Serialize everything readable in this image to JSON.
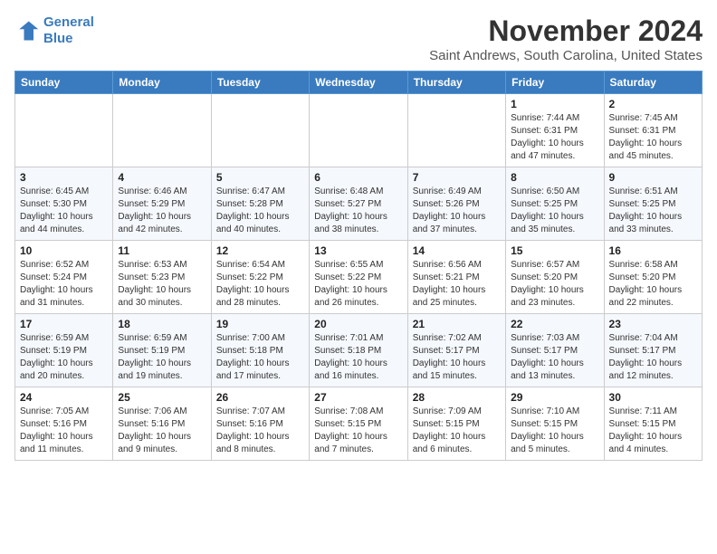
{
  "header": {
    "logo_line1": "General",
    "logo_line2": "Blue",
    "month_title": "November 2024",
    "location": "Saint Andrews, South Carolina, United States"
  },
  "weekdays": [
    "Sunday",
    "Monday",
    "Tuesday",
    "Wednesday",
    "Thursday",
    "Friday",
    "Saturday"
  ],
  "weeks": [
    [
      {
        "day": "",
        "info": ""
      },
      {
        "day": "",
        "info": ""
      },
      {
        "day": "",
        "info": ""
      },
      {
        "day": "",
        "info": ""
      },
      {
        "day": "",
        "info": ""
      },
      {
        "day": "1",
        "info": "Sunrise: 7:44 AM\nSunset: 6:31 PM\nDaylight: 10 hours\nand 47 minutes."
      },
      {
        "day": "2",
        "info": "Sunrise: 7:45 AM\nSunset: 6:31 PM\nDaylight: 10 hours\nand 45 minutes."
      }
    ],
    [
      {
        "day": "3",
        "info": "Sunrise: 6:45 AM\nSunset: 5:30 PM\nDaylight: 10 hours\nand 44 minutes."
      },
      {
        "day": "4",
        "info": "Sunrise: 6:46 AM\nSunset: 5:29 PM\nDaylight: 10 hours\nand 42 minutes."
      },
      {
        "day": "5",
        "info": "Sunrise: 6:47 AM\nSunset: 5:28 PM\nDaylight: 10 hours\nand 40 minutes."
      },
      {
        "day": "6",
        "info": "Sunrise: 6:48 AM\nSunset: 5:27 PM\nDaylight: 10 hours\nand 38 minutes."
      },
      {
        "day": "7",
        "info": "Sunrise: 6:49 AM\nSunset: 5:26 PM\nDaylight: 10 hours\nand 37 minutes."
      },
      {
        "day": "8",
        "info": "Sunrise: 6:50 AM\nSunset: 5:25 PM\nDaylight: 10 hours\nand 35 minutes."
      },
      {
        "day": "9",
        "info": "Sunrise: 6:51 AM\nSunset: 5:25 PM\nDaylight: 10 hours\nand 33 minutes."
      }
    ],
    [
      {
        "day": "10",
        "info": "Sunrise: 6:52 AM\nSunset: 5:24 PM\nDaylight: 10 hours\nand 31 minutes."
      },
      {
        "day": "11",
        "info": "Sunrise: 6:53 AM\nSunset: 5:23 PM\nDaylight: 10 hours\nand 30 minutes."
      },
      {
        "day": "12",
        "info": "Sunrise: 6:54 AM\nSunset: 5:22 PM\nDaylight: 10 hours\nand 28 minutes."
      },
      {
        "day": "13",
        "info": "Sunrise: 6:55 AM\nSunset: 5:22 PM\nDaylight: 10 hours\nand 26 minutes."
      },
      {
        "day": "14",
        "info": "Sunrise: 6:56 AM\nSunset: 5:21 PM\nDaylight: 10 hours\nand 25 minutes."
      },
      {
        "day": "15",
        "info": "Sunrise: 6:57 AM\nSunset: 5:20 PM\nDaylight: 10 hours\nand 23 minutes."
      },
      {
        "day": "16",
        "info": "Sunrise: 6:58 AM\nSunset: 5:20 PM\nDaylight: 10 hours\nand 22 minutes."
      }
    ],
    [
      {
        "day": "17",
        "info": "Sunrise: 6:59 AM\nSunset: 5:19 PM\nDaylight: 10 hours\nand 20 minutes."
      },
      {
        "day": "18",
        "info": "Sunrise: 6:59 AM\nSunset: 5:19 PM\nDaylight: 10 hours\nand 19 minutes."
      },
      {
        "day": "19",
        "info": "Sunrise: 7:00 AM\nSunset: 5:18 PM\nDaylight: 10 hours\nand 17 minutes."
      },
      {
        "day": "20",
        "info": "Sunrise: 7:01 AM\nSunset: 5:18 PM\nDaylight: 10 hours\nand 16 minutes."
      },
      {
        "day": "21",
        "info": "Sunrise: 7:02 AM\nSunset: 5:17 PM\nDaylight: 10 hours\nand 15 minutes."
      },
      {
        "day": "22",
        "info": "Sunrise: 7:03 AM\nSunset: 5:17 PM\nDaylight: 10 hours\nand 13 minutes."
      },
      {
        "day": "23",
        "info": "Sunrise: 7:04 AM\nSunset: 5:17 PM\nDaylight: 10 hours\nand 12 minutes."
      }
    ],
    [
      {
        "day": "24",
        "info": "Sunrise: 7:05 AM\nSunset: 5:16 PM\nDaylight: 10 hours\nand 11 minutes."
      },
      {
        "day": "25",
        "info": "Sunrise: 7:06 AM\nSunset: 5:16 PM\nDaylight: 10 hours\nand 9 minutes."
      },
      {
        "day": "26",
        "info": "Sunrise: 7:07 AM\nSunset: 5:16 PM\nDaylight: 10 hours\nand 8 minutes."
      },
      {
        "day": "27",
        "info": "Sunrise: 7:08 AM\nSunset: 5:15 PM\nDaylight: 10 hours\nand 7 minutes."
      },
      {
        "day": "28",
        "info": "Sunrise: 7:09 AM\nSunset: 5:15 PM\nDaylight: 10 hours\nand 6 minutes."
      },
      {
        "day": "29",
        "info": "Sunrise: 7:10 AM\nSunset: 5:15 PM\nDaylight: 10 hours\nand 5 minutes."
      },
      {
        "day": "30",
        "info": "Sunrise: 7:11 AM\nSunset: 5:15 PM\nDaylight: 10 hours\nand 4 minutes."
      }
    ]
  ]
}
